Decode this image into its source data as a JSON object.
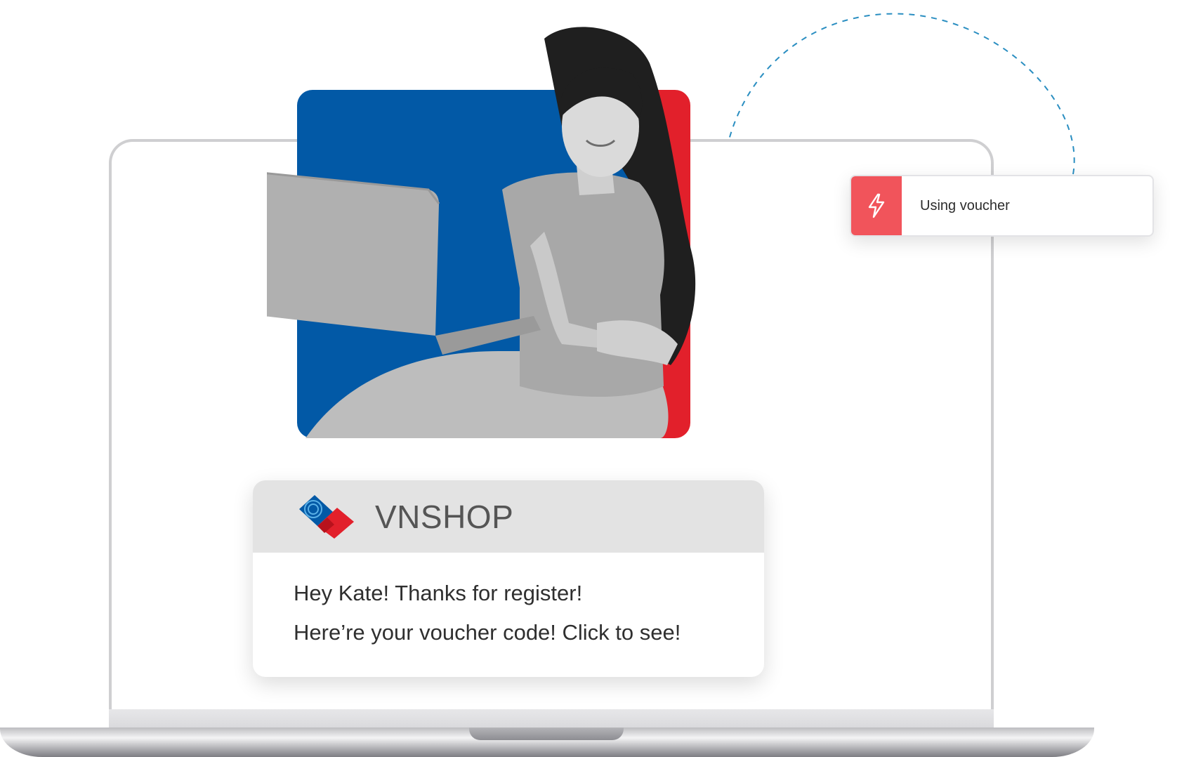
{
  "voucher_chip": {
    "label": "Using voucher",
    "icon": "lightning-bolt-icon",
    "accent_color": "#f1545b"
  },
  "notification": {
    "brand": "VNSHOP",
    "lines": [
      "Hey Kate! Thanks for register!",
      "Here’re your voucher code! Click to see!"
    ]
  },
  "colors": {
    "brand_blue": "#0259a6",
    "brand_red": "#e2202b",
    "dash_line": "#2a8ec1"
  }
}
